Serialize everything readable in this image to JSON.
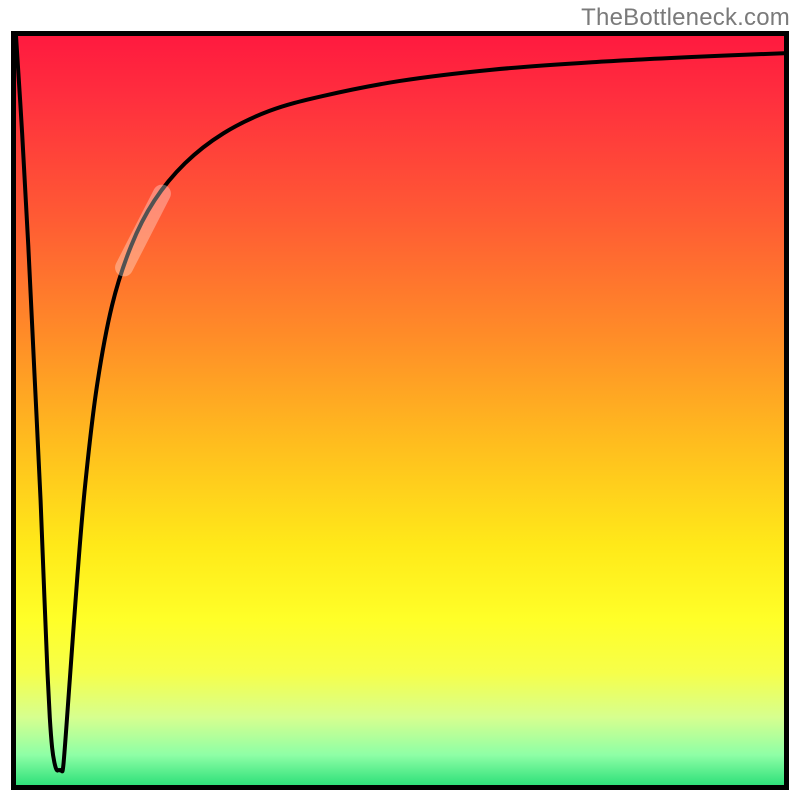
{
  "watermark": "TheBottleneck.com",
  "colors": {
    "frame": "#000000",
    "curve": "#000000",
    "gradient_top": "#ff1a3f",
    "gradient_bottom": "#2fe07a",
    "watermark": "#7a7a7a",
    "highlight_overlay": "rgba(255,255,255,0.32)"
  },
  "chart_data": {
    "type": "line",
    "title": "",
    "xlabel": "",
    "ylabel": "",
    "xlim": [
      0,
      100
    ],
    "ylim": [
      0,
      100
    ],
    "grid": false,
    "legend": false,
    "background_gradient": {
      "direction": "vertical",
      "stops": [
        {
          "pos": 0.0,
          "color": "#ff1a3f"
        },
        {
          "pos": 0.4,
          "color": "#ff8c28"
        },
        {
          "pos": 0.78,
          "color": "#ffff28"
        },
        {
          "pos": 1.0,
          "color": "#2fe07a"
        }
      ]
    },
    "series": [
      {
        "name": "left-drop",
        "x": [
          0.0,
          0.8,
          1.6,
          2.4,
          3.2,
          3.7,
          4.1,
          4.4,
          4.7,
          5.0
        ],
        "y": [
          100,
          87,
          72,
          55,
          38,
          25,
          15,
          9,
          5,
          3
        ]
      },
      {
        "name": "trough",
        "x": [
          5.0,
          5.3,
          5.6,
          5.9,
          6.2
        ],
        "y": [
          3,
          2,
          2,
          2,
          3
        ]
      },
      {
        "name": "main-rise",
        "x": [
          6.2,
          7.0,
          8.0,
          9.0,
          10.5,
          12.5,
          15.0,
          18.0,
          22.0,
          27.0,
          33.0,
          40.0,
          50.0,
          62.0,
          75.0,
          88.0,
          100.0
        ],
        "y": [
          3,
          14,
          28,
          40,
          53,
          64,
          72,
          78,
          83,
          87,
          90,
          92,
          94,
          95.5,
          96.5,
          97.2,
          97.7
        ]
      }
    ],
    "annotations": [
      {
        "name": "highlighted-segment",
        "type": "segment-overlay",
        "along_series": "main-rise",
        "x_range": [
          13.5,
          19.5
        ],
        "y_range": [
          68,
          80
        ],
        "style": "semi-transparent-white"
      }
    ]
  }
}
